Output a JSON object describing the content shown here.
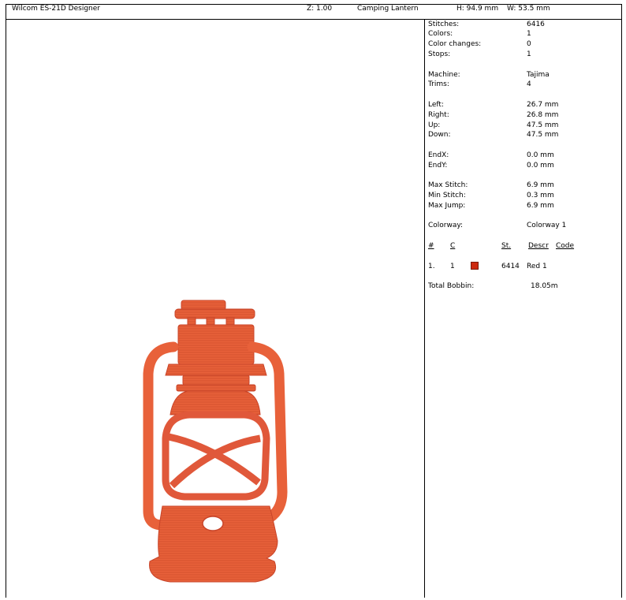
{
  "header": {
    "app_title": "Wilcom ES-21D Designer",
    "zoom": "Z: 1.00",
    "design_name": "Camping Lantern",
    "height": "H: 94.9 mm",
    "width": "W: 53.5 mm"
  },
  "stats": [
    {
      "label": "Stitches:",
      "value": "6416"
    },
    {
      "label": "Colors:",
      "value": "1"
    },
    {
      "label": "Color changes:",
      "value": "0"
    },
    {
      "label": "Stops:",
      "value": "1"
    },
    {
      "label": "Machine:",
      "value": "Tajima"
    },
    {
      "label": "Trims:",
      "value": "4"
    },
    {
      "label": "Left:",
      "value": "26.7 mm"
    },
    {
      "label": "Right:",
      "value": "26.8 mm"
    },
    {
      "label": "Up:",
      "value": "47.5 mm"
    },
    {
      "label": "Down:",
      "value": "47.5 mm"
    },
    {
      "label": "EndX:",
      "value": "0.0 mm"
    },
    {
      "label": "EndY:",
      "value": "0.0 mm"
    },
    {
      "label": "Max Stitch:",
      "value": "6.9 mm"
    },
    {
      "label": "Min Stitch:",
      "value": "0.3 mm"
    },
    {
      "label": "Max Jump:",
      "value": "6.9 mm"
    },
    {
      "label": "Colorway:",
      "value": "Colorway 1"
    }
  ],
  "color_table": {
    "headers": {
      "num": "#",
      "c": "C",
      "st": "St.",
      "descr": "Descr",
      "code": "Code"
    },
    "rows": [
      {
        "num": "1.",
        "c": "1",
        "st": "6414",
        "descr": "Red 1",
        "swatch_color": "#cc2a10"
      }
    ]
  },
  "bobbin": {
    "label": "Total Bobbin:",
    "value": "18.05m"
  },
  "design_color": "#e8613a",
  "design_icon": "lantern-embroidery"
}
